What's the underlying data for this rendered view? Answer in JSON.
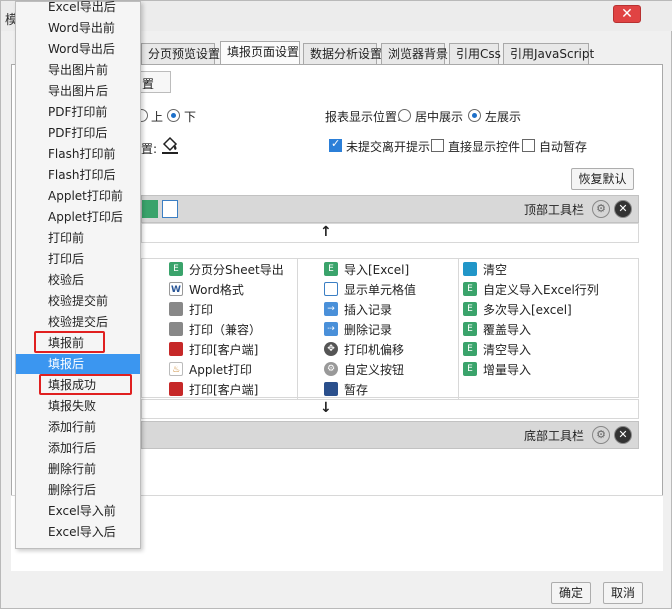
{
  "window": {
    "title": "模"
  },
  "tabs": [
    {
      "label": "分页预览设置"
    },
    {
      "label": "填报页面设置"
    },
    {
      "label": "数据分析设置"
    },
    {
      "label": "浏览器背景"
    },
    {
      "label": "引用Css"
    },
    {
      "label": "引用JavaScript"
    }
  ],
  "settings": {
    "select_value": "置",
    "position_up": "上",
    "position_down": "下",
    "display_position_label": "报表显示位置:",
    "center_label": "居中展示",
    "left_label": "左展示",
    "unsubmitted_label": "未提交离开提示",
    "show_controls_label": "直接显示控件",
    "auto_save_label": "自动暂存",
    "bg_label": "置:",
    "restore_default": "恢复默认"
  },
  "top_toolbar": {
    "label": "顶部工具栏"
  },
  "bottom_toolbar": {
    "label": "底部工具栏"
  },
  "grid": {
    "col1": [
      "分页分Sheet导出",
      "Word格式",
      "打印",
      "打印（兼容）",
      "打印[客户端]",
      "Applet打印",
      "打印[客户端]"
    ],
    "col2": [
      "导入[Excel]",
      "显示单元格值",
      "插入记录",
      "删除记录",
      "打印机偏移",
      "自定义按钮",
      "暂存"
    ],
    "col3": [
      "清空",
      "自定义导入Excel行列",
      "多次导入[excel]",
      "覆盖导入",
      "清空导入",
      "增量导入"
    ]
  },
  "dropdown": {
    "items": [
      "Excel导出后",
      "Word导出前",
      "Word导出后",
      "导出图片前",
      "导出图片后",
      "PDF打印前",
      "PDF打印后",
      "Flash打印前",
      "Flash打印后",
      "Applet打印前",
      "Applet打印后",
      "打印前",
      "打印后",
      "校验后",
      "校验提交前",
      "校验提交后",
      "填报前",
      "填报后",
      "填报成功",
      "填报失败",
      "添加行前",
      "添加行后",
      "删除行前",
      "删除行后",
      "Excel导入前",
      "Excel导入后"
    ],
    "selected_index": 17
  },
  "footer": {
    "ok": "确定",
    "cancel": "取消"
  },
  "colors": {
    "selected": "#3b96f0",
    "highlight": "#e02020",
    "close": "#e04343"
  }
}
